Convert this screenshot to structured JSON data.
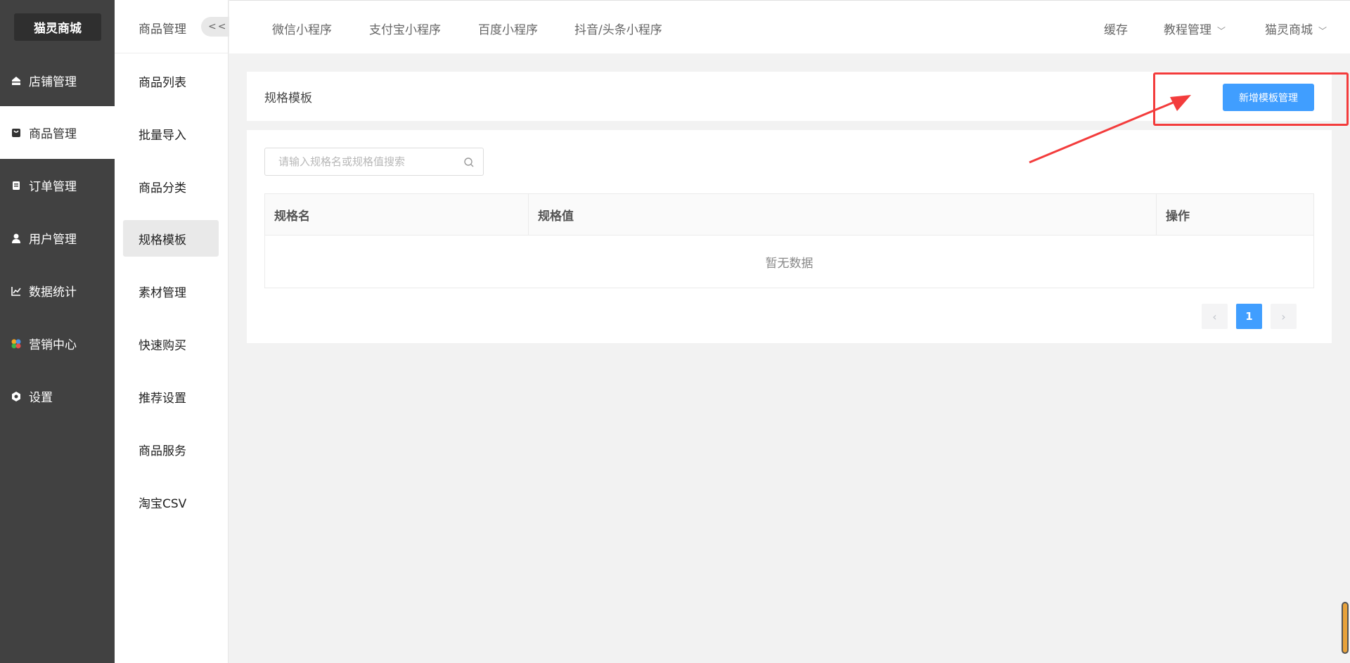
{
  "app": {
    "logo": "猫灵商城"
  },
  "sidebar": {
    "items": [
      {
        "label": "店铺管理",
        "icon": "store-icon"
      },
      {
        "label": "商品管理",
        "icon": "product-icon",
        "active": true
      },
      {
        "label": "订单管理",
        "icon": "order-icon"
      },
      {
        "label": "用户管理",
        "icon": "user-icon"
      },
      {
        "label": "数据统计",
        "icon": "chart-icon"
      },
      {
        "label": "营销中心",
        "icon": "marketing-icon"
      },
      {
        "label": "设置",
        "icon": "settings-icon"
      }
    ]
  },
  "subnav": {
    "title": "商品管理",
    "collapse_label": "<<",
    "items": [
      {
        "label": "商品列表"
      },
      {
        "label": "批量导入"
      },
      {
        "label": "商品分类"
      },
      {
        "label": "规格模板",
        "active": true
      },
      {
        "label": "素材管理"
      },
      {
        "label": "快速购买"
      },
      {
        "label": "推荐设置"
      },
      {
        "label": "商品服务"
      },
      {
        "label": "淘宝CSV"
      }
    ]
  },
  "topbar": {
    "platforms": [
      "微信小程序",
      "支付宝小程序",
      "百度小程序",
      "抖音/头条小程序"
    ],
    "cache": "缓存",
    "tutorial": "教程管理",
    "store": "猫灵商城"
  },
  "page": {
    "title": "规格模板",
    "add_button": "新增模板管理",
    "search_placeholder": "请输入规格名或规格值搜索",
    "columns": [
      "规格名",
      "规格值",
      "操作"
    ],
    "empty_text": "暂无数据",
    "pagination": {
      "current": "1",
      "prev": "‹",
      "next": "›"
    }
  },
  "colors": {
    "primary": "#409eff",
    "sidebar": "#414141",
    "annotation": "#f33c3c"
  }
}
